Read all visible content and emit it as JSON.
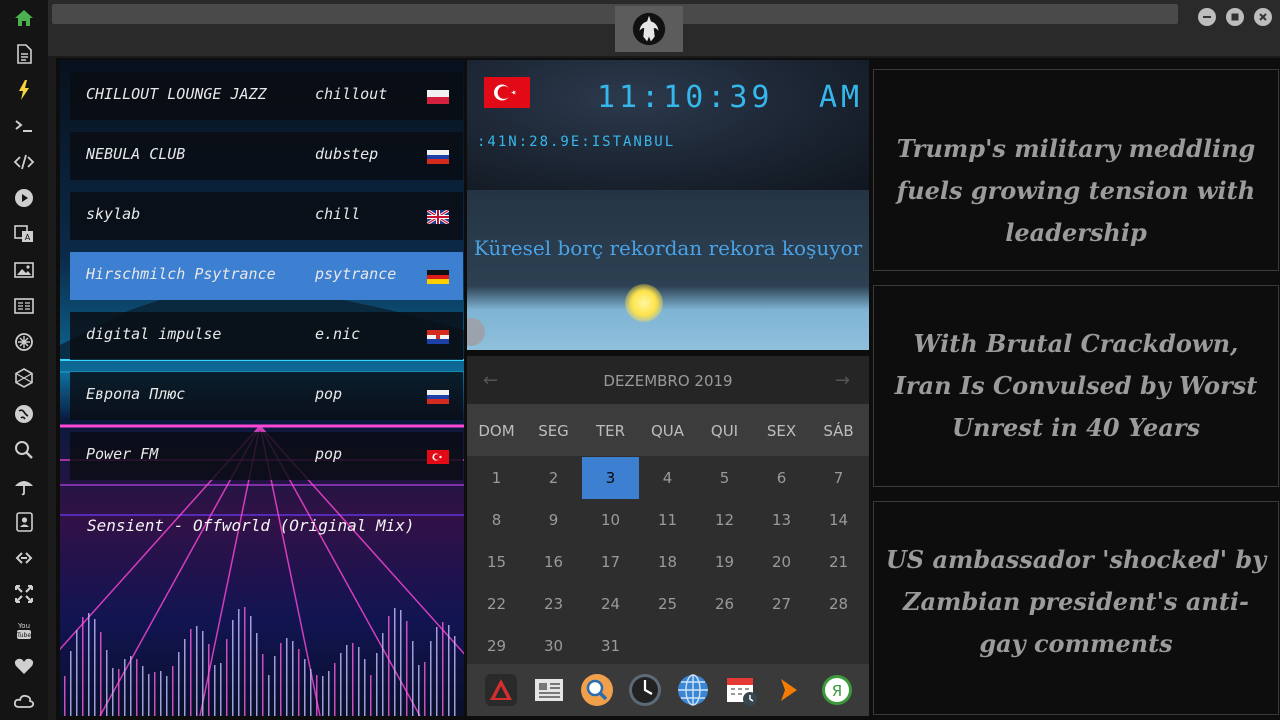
{
  "colors": {
    "accent": "#3d7fd0",
    "clock": "#36b7ec",
    "news_text": "#9b9b9b",
    "home_icon": "#4caf50",
    "lightning_icon": "#f5d53b"
  },
  "sidebar": {
    "icons": [
      "home-icon",
      "document-icon",
      "lightning-icon",
      "terminal-icon",
      "code-icon",
      "play-icon",
      "translate-icon",
      "image-icon",
      "news-icon",
      "settings-icon",
      "hexagon-icon",
      "globe-icon",
      "search-icon",
      "umbrella-icon",
      "contact-icon",
      "link-icon",
      "resize-icon",
      "youtube-icon",
      "heart-icon",
      "cloud-icon"
    ]
  },
  "window": {
    "logo": "rebel-alliance-logo",
    "buttons": [
      "minimize",
      "maximize",
      "close"
    ]
  },
  "radio": {
    "stations": [
      {
        "name": "CHILLOUT LOUNGE JAZZ",
        "genre": "chillout",
        "flag": "poland"
      },
      {
        "name": "NEBULA CLUB",
        "genre": "dubstep",
        "flag": "russia"
      },
      {
        "name": "skylab",
        "genre": "chill",
        "flag": "united-kingdom"
      },
      {
        "name": "Hirschmilch Psytrance",
        "genre": "psytrance",
        "flag": "germany",
        "active": true
      },
      {
        "name": "digital impulse",
        "genre": "e.nic",
        "flag": "croatia"
      },
      {
        "name": "Европа Плюс",
        "genre": "pop",
        "flag": "russia"
      },
      {
        "name": "Power FM",
        "genre": "pop",
        "flag": "turkey"
      }
    ],
    "now_playing": "Sensient - Offworld (Original Mix)"
  },
  "clock": {
    "time": "11:10:39",
    "ampm": "AM",
    "location": ":41N:28.9E:ISTANBUL",
    "flag": "turkey"
  },
  "weather": {
    "headline": "Küresel borç rekordan rekora koşuyor"
  },
  "calendar": {
    "month": "DEZEMBRO 2019",
    "weekdays": [
      "DOM",
      "SEG",
      "TER",
      "QUA",
      "QUI",
      "SEX",
      "SÁB"
    ],
    "today": 3,
    "days": [
      1,
      2,
      3,
      4,
      5,
      6,
      7,
      8,
      9,
      10,
      11,
      12,
      13,
      14,
      15,
      16,
      17,
      18,
      19,
      20,
      21,
      22,
      23,
      24,
      25,
      26,
      27,
      28,
      29,
      30,
      31
    ]
  },
  "dock": {
    "icons": [
      "launcher-icon",
      "news-reader-icon",
      "search-app-icon",
      "clock-app-icon",
      "browser-icon",
      "calendar-app-icon",
      "arrow-app-icon",
      "yandex-icon"
    ]
  },
  "news": [
    "Trump's military meddling fuels growing tension with leadership",
    "With Brutal Crackdown, Iran Is Convulsed by Worst Unrest in 40 Years",
    "US ambassador 'shocked' by Zambian president's anti-gay comments"
  ]
}
